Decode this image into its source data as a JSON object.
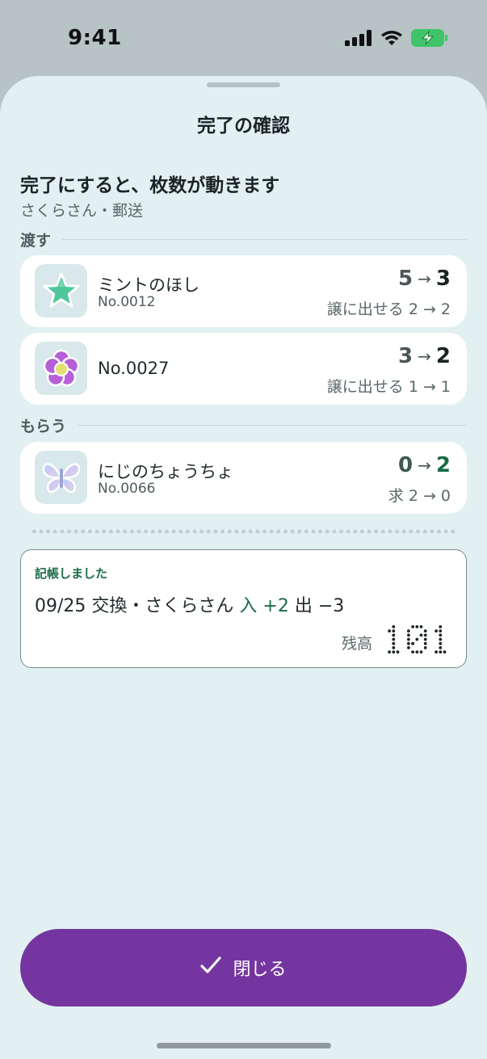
{
  "status_bar": {
    "time": "9:41"
  },
  "sheet": {
    "title": "完了の確認",
    "headline": "完了にすると、枚数が動きます",
    "subline": "さくらさん・郵送"
  },
  "give": {
    "label": "渡す",
    "items": [
      {
        "name": "ミントのほし",
        "number": "No.0012",
        "from": "5",
        "arrow": "→",
        "to": "3",
        "caption": "譲に出せる 2 → 2",
        "icon": "star-sticker-icon"
      },
      {
        "name": "",
        "number": "No.0027",
        "from": "3",
        "arrow": "→",
        "to": "2",
        "caption": "譲に出せる 1 → 1",
        "icon": "flower-sticker-icon"
      }
    ]
  },
  "receive": {
    "label": "もらう",
    "items": [
      {
        "name": "にじのちょうちょ",
        "number": "No.0066",
        "from": "0",
        "arrow": "→",
        "to": "2",
        "caption": "求 2 → 0",
        "icon": "butterfly-sticker-icon"
      }
    ]
  },
  "ledger": {
    "label": "記帳しました",
    "entry": "09/25 交換・さくらさん",
    "in_text": "入 +2",
    "out_text": "出 −3",
    "balance_label": "残高",
    "balance": "101"
  },
  "close_button": {
    "label": "閉じる",
    "icon": "check-icon"
  },
  "colors": {
    "accent": "#7535a0",
    "green": "#1a6b46",
    "sheet_bg": "#e2f0f1"
  }
}
